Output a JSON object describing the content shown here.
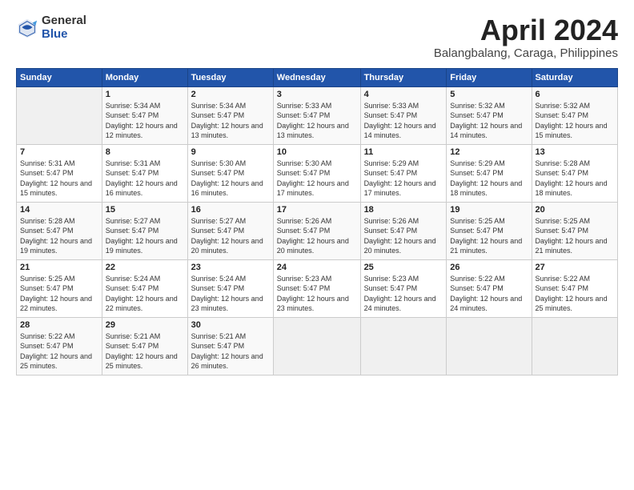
{
  "header": {
    "logo_general": "General",
    "logo_blue": "Blue",
    "month_title": "April 2024",
    "location": "Balangbalang, Caraga, Philippines"
  },
  "weekdays": [
    "Sunday",
    "Monday",
    "Tuesday",
    "Wednesday",
    "Thursday",
    "Friday",
    "Saturday"
  ],
  "weeks": [
    [
      {
        "day": "",
        "sunrise": "",
        "sunset": "",
        "daylight": ""
      },
      {
        "day": "1",
        "sunrise": "Sunrise: 5:34 AM",
        "sunset": "Sunset: 5:47 PM",
        "daylight": "Daylight: 12 hours and 12 minutes."
      },
      {
        "day": "2",
        "sunrise": "Sunrise: 5:34 AM",
        "sunset": "Sunset: 5:47 PM",
        "daylight": "Daylight: 12 hours and 13 minutes."
      },
      {
        "day": "3",
        "sunrise": "Sunrise: 5:33 AM",
        "sunset": "Sunset: 5:47 PM",
        "daylight": "Daylight: 12 hours and 13 minutes."
      },
      {
        "day": "4",
        "sunrise": "Sunrise: 5:33 AM",
        "sunset": "Sunset: 5:47 PM",
        "daylight": "Daylight: 12 hours and 14 minutes."
      },
      {
        "day": "5",
        "sunrise": "Sunrise: 5:32 AM",
        "sunset": "Sunset: 5:47 PM",
        "daylight": "Daylight: 12 hours and 14 minutes."
      },
      {
        "day": "6",
        "sunrise": "Sunrise: 5:32 AM",
        "sunset": "Sunset: 5:47 PM",
        "daylight": "Daylight: 12 hours and 15 minutes."
      }
    ],
    [
      {
        "day": "7",
        "sunrise": "Sunrise: 5:31 AM",
        "sunset": "Sunset: 5:47 PM",
        "daylight": "Daylight: 12 hours and 15 minutes."
      },
      {
        "day": "8",
        "sunrise": "Sunrise: 5:31 AM",
        "sunset": "Sunset: 5:47 PM",
        "daylight": "Daylight: 12 hours and 16 minutes."
      },
      {
        "day": "9",
        "sunrise": "Sunrise: 5:30 AM",
        "sunset": "Sunset: 5:47 PM",
        "daylight": "Daylight: 12 hours and 16 minutes."
      },
      {
        "day": "10",
        "sunrise": "Sunrise: 5:30 AM",
        "sunset": "Sunset: 5:47 PM",
        "daylight": "Daylight: 12 hours and 17 minutes."
      },
      {
        "day": "11",
        "sunrise": "Sunrise: 5:29 AM",
        "sunset": "Sunset: 5:47 PM",
        "daylight": "Daylight: 12 hours and 17 minutes."
      },
      {
        "day": "12",
        "sunrise": "Sunrise: 5:29 AM",
        "sunset": "Sunset: 5:47 PM",
        "daylight": "Daylight: 12 hours and 18 minutes."
      },
      {
        "day": "13",
        "sunrise": "Sunrise: 5:28 AM",
        "sunset": "Sunset: 5:47 PM",
        "daylight": "Daylight: 12 hours and 18 minutes."
      }
    ],
    [
      {
        "day": "14",
        "sunrise": "Sunrise: 5:28 AM",
        "sunset": "Sunset: 5:47 PM",
        "daylight": "Daylight: 12 hours and 19 minutes."
      },
      {
        "day": "15",
        "sunrise": "Sunrise: 5:27 AM",
        "sunset": "Sunset: 5:47 PM",
        "daylight": "Daylight: 12 hours and 19 minutes."
      },
      {
        "day": "16",
        "sunrise": "Sunrise: 5:27 AM",
        "sunset": "Sunset: 5:47 PM",
        "daylight": "Daylight: 12 hours and 20 minutes."
      },
      {
        "day": "17",
        "sunrise": "Sunrise: 5:26 AM",
        "sunset": "Sunset: 5:47 PM",
        "daylight": "Daylight: 12 hours and 20 minutes."
      },
      {
        "day": "18",
        "sunrise": "Sunrise: 5:26 AM",
        "sunset": "Sunset: 5:47 PM",
        "daylight": "Daylight: 12 hours and 20 minutes."
      },
      {
        "day": "19",
        "sunrise": "Sunrise: 5:25 AM",
        "sunset": "Sunset: 5:47 PM",
        "daylight": "Daylight: 12 hours and 21 minutes."
      },
      {
        "day": "20",
        "sunrise": "Sunrise: 5:25 AM",
        "sunset": "Sunset: 5:47 PM",
        "daylight": "Daylight: 12 hours and 21 minutes."
      }
    ],
    [
      {
        "day": "21",
        "sunrise": "Sunrise: 5:25 AM",
        "sunset": "Sunset: 5:47 PM",
        "daylight": "Daylight: 12 hours and 22 minutes."
      },
      {
        "day": "22",
        "sunrise": "Sunrise: 5:24 AM",
        "sunset": "Sunset: 5:47 PM",
        "daylight": "Daylight: 12 hours and 22 minutes."
      },
      {
        "day": "23",
        "sunrise": "Sunrise: 5:24 AM",
        "sunset": "Sunset: 5:47 PM",
        "daylight": "Daylight: 12 hours and 23 minutes."
      },
      {
        "day": "24",
        "sunrise": "Sunrise: 5:23 AM",
        "sunset": "Sunset: 5:47 PM",
        "daylight": "Daylight: 12 hours and 23 minutes."
      },
      {
        "day": "25",
        "sunrise": "Sunrise: 5:23 AM",
        "sunset": "Sunset: 5:47 PM",
        "daylight": "Daylight: 12 hours and 24 minutes."
      },
      {
        "day": "26",
        "sunrise": "Sunrise: 5:22 AM",
        "sunset": "Sunset: 5:47 PM",
        "daylight": "Daylight: 12 hours and 24 minutes."
      },
      {
        "day": "27",
        "sunrise": "Sunrise: 5:22 AM",
        "sunset": "Sunset: 5:47 PM",
        "daylight": "Daylight: 12 hours and 25 minutes."
      }
    ],
    [
      {
        "day": "28",
        "sunrise": "Sunrise: 5:22 AM",
        "sunset": "Sunset: 5:47 PM",
        "daylight": "Daylight: 12 hours and 25 minutes."
      },
      {
        "day": "29",
        "sunrise": "Sunrise: 5:21 AM",
        "sunset": "Sunset: 5:47 PM",
        "daylight": "Daylight: 12 hours and 25 minutes."
      },
      {
        "day": "30",
        "sunrise": "Sunrise: 5:21 AM",
        "sunset": "Sunset: 5:47 PM",
        "daylight": "Daylight: 12 hours and 26 minutes."
      },
      {
        "day": "",
        "sunrise": "",
        "sunset": "",
        "daylight": ""
      },
      {
        "day": "",
        "sunrise": "",
        "sunset": "",
        "daylight": ""
      },
      {
        "day": "",
        "sunrise": "",
        "sunset": "",
        "daylight": ""
      },
      {
        "day": "",
        "sunrise": "",
        "sunset": "",
        "daylight": ""
      }
    ]
  ]
}
